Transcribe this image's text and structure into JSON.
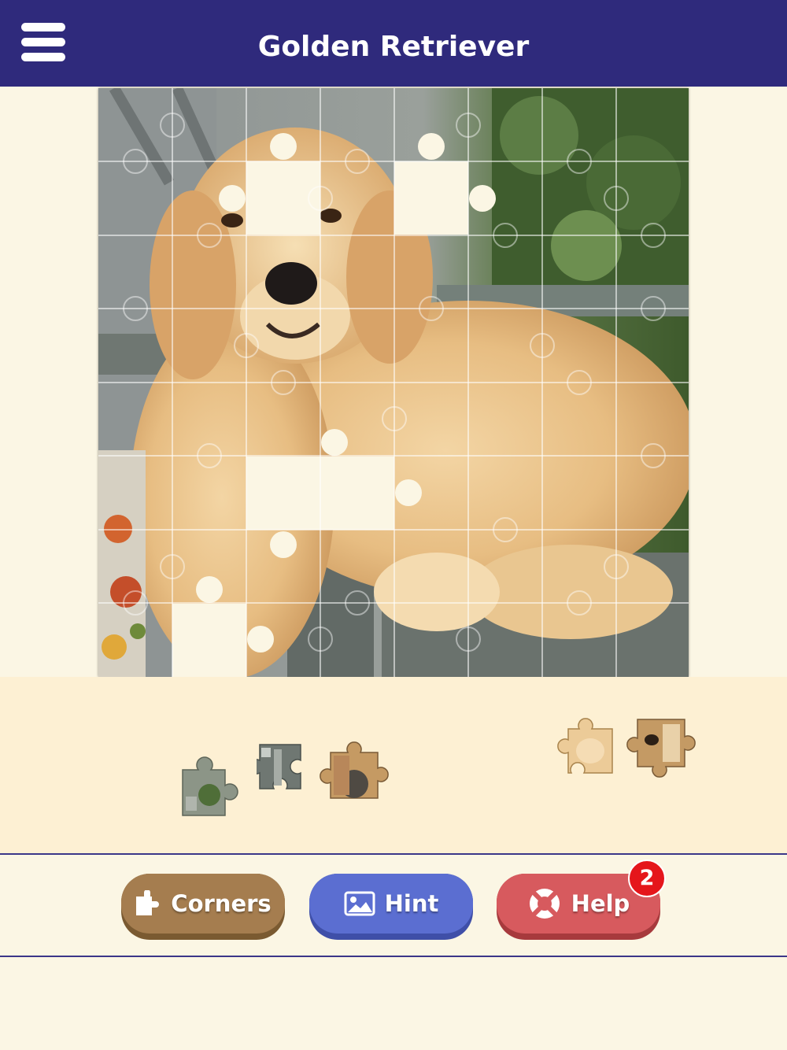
{
  "header": {
    "title": "Golden Retriever",
    "menu_icon": "hamburger-menu-icon",
    "background": "#2f2a7c"
  },
  "board": {
    "image_subject": "golden-retriever-on-chair",
    "grid_rows": 8,
    "grid_cols": 8,
    "empty_slots": [
      {
        "row": 1,
        "col": 2
      },
      {
        "row": 1,
        "col": 4
      },
      {
        "row": 5,
        "col": 2
      },
      {
        "row": 5,
        "col": 3
      },
      {
        "row": 7,
        "col": 1
      }
    ]
  },
  "tray": {
    "pieces_count": 5,
    "pieces": [
      {
        "name": "tray-piece-1",
        "tone": "greenish"
      },
      {
        "name": "tray-piece-2",
        "tone": "gray-wood"
      },
      {
        "name": "tray-piece-3",
        "tone": "dark-fur"
      },
      {
        "name": "tray-piece-4",
        "tone": "light-fur"
      },
      {
        "name": "tray-piece-5",
        "tone": "eye-fur"
      }
    ]
  },
  "toolbar": {
    "corners_label": "Corners",
    "corners_icon": "corner-piece-icon",
    "hint_label": "Hint",
    "hint_icon": "picture-icon",
    "help_label": "Help",
    "help_icon": "lifebuoy-icon",
    "help_badge": "2"
  },
  "colors": {
    "header": "#2f2a7c",
    "background": "#fbf6e4",
    "tray": "#fdf0d3",
    "corners_button": "#a57d4f",
    "hint_button": "#5b6ed1",
    "help_button": "#d75a5e",
    "badge": "#e5161b"
  }
}
